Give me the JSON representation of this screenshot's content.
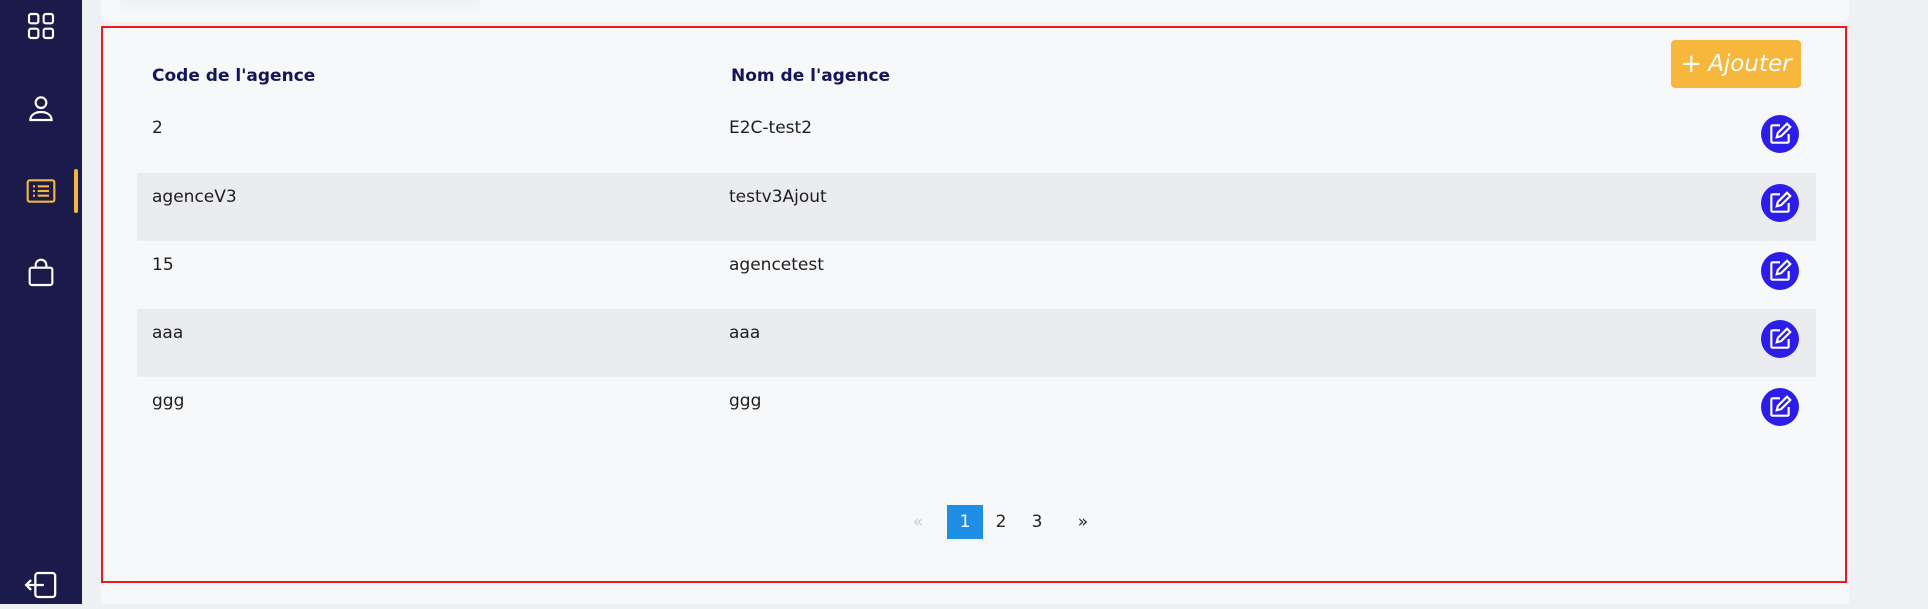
{
  "table": {
    "headers": {
      "code": "Code de l'agence",
      "name": "Nom de l'agence"
    },
    "add_label": "Ajouter",
    "rows": [
      {
        "code": "2",
        "name": "E2C-test2"
      },
      {
        "code": "agenceV3",
        "name": "testv3Ajout"
      },
      {
        "code": "15",
        "name": "agencetest"
      },
      {
        "code": "aaa",
        "name": "aaa"
      },
      {
        "code": "ggg",
        "name": "ggg"
      }
    ]
  },
  "pagination": {
    "prev": "«",
    "pages": [
      "1",
      "2",
      "3"
    ],
    "current": "1",
    "next": "»"
  },
  "sidebar": {
    "icons": [
      "dashboard-grid-icon",
      "user-icon",
      "list-icon",
      "shopping-bag-icon",
      "logout-icon"
    ],
    "active": "list-icon"
  },
  "colors": {
    "sidebar_bg": "#1a1b4a",
    "accent": "#f4b73d",
    "edit_button": "#2c1ee8",
    "page_active": "#1f8fe6",
    "header_text": "#14145a",
    "highlight_frame": "#e51d1d"
  }
}
